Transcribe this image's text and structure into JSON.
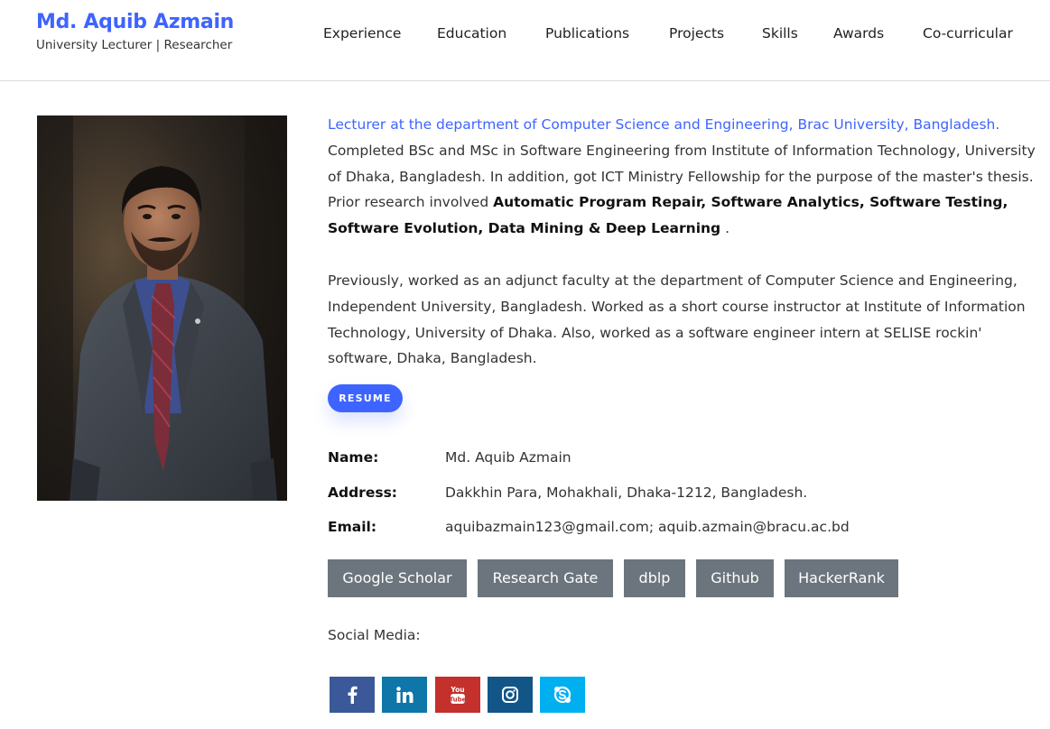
{
  "header": {
    "name": "Md. Aquib Azmain",
    "subtitle": "University Lecturer | Researcher",
    "nav": [
      "Experience",
      "Education",
      "Publications",
      "Projects",
      "Skills",
      "Awards",
      "Co-curricular"
    ]
  },
  "bio": {
    "lead": "Lecturer at the department of Computer Science and Engineering, Brac University, Bangladesh.",
    "p1_text": "Completed BSc and MSc in Software Engineering from Institute of Information Technology, University of Dhaka, Bangladesh. In addition, got ICT Ministry Fellowship for the purpose of the master's thesis. Prior research involved",
    "p1_strong": "Automatic Program Repair, Software Analytics, Software Testing, Software Evolution, Data Mining & Deep Learning",
    "p1_end": ".",
    "p2": "Previously, worked as an adjunct faculty at the department of Computer Science and Engineering, Independent University, Bangladesh. Worked as a short course instructor at Institute of Information Technology, University of Dhaka. Also, worked as a software engineer intern at SELISE rockin' software, Dhaka, Bangladesh."
  },
  "resume_label": "RESUME",
  "info": {
    "name_label": "Name:",
    "name_value": "Md. Aquib Azmain",
    "address_label": "Address:",
    "address_value": "Dakkhin Para, Mohakhali, Dhaka-1212, Bangladesh.",
    "email_label": "Email:",
    "email_value": "aquibazmain123@gmail.com; aquib.azmain@bracu.ac.bd"
  },
  "profile_links": [
    "Google Scholar",
    "Research Gate",
    "dblp",
    "Github",
    "HackerRank"
  ],
  "social": {
    "label": "Social Media:",
    "icons": [
      {
        "name": "facebook-icon",
        "color": "#3b5998"
      },
      {
        "name": "linkedin-icon",
        "color": "#0e76a8"
      },
      {
        "name": "youtube-icon",
        "color": "#c4302b"
      },
      {
        "name": "instagram-icon",
        "color": "#125688"
      },
      {
        "name": "skype-icon",
        "color": "#00aff0"
      }
    ]
  },
  "colors": {
    "accent": "#3e64ff",
    "link_button": "#6c757d"
  }
}
